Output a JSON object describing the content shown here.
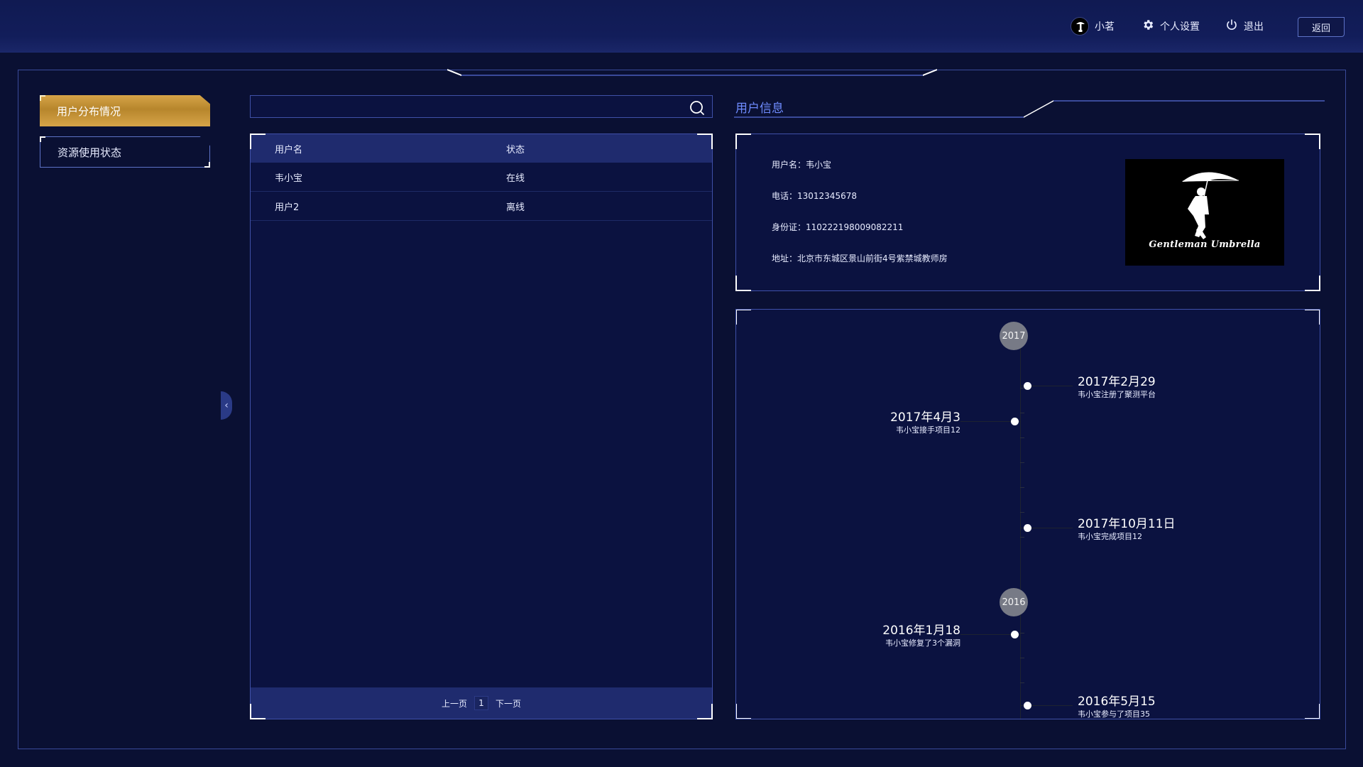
{
  "topbar": {
    "user_name": "小茗",
    "settings_label": "个人设置",
    "logout_label": "退出",
    "back_label": "返回"
  },
  "menu": {
    "items": [
      {
        "label": "用户分布情况",
        "active": true
      },
      {
        "label": "资源使用状态",
        "active": false
      }
    ]
  },
  "search": {
    "value": "",
    "placeholder": ""
  },
  "table": {
    "headers": {
      "name": "用户名",
      "status": "状态"
    },
    "rows": [
      {
        "name": "韦小宝",
        "status": "在线"
      },
      {
        "name": "用户2",
        "status": "离线"
      }
    ]
  },
  "pager": {
    "prev_label": "上一页",
    "current": "1",
    "next_label": "下一页"
  },
  "user_info": {
    "title": "用户信息",
    "name_line": "用户名：韦小宝",
    "phone_line": "电话：13012345678",
    "id_line": "身份证：110222198009082211",
    "address_line": "地址：北京市东城区景山前街4号紫禁城教师房",
    "portrait_caption": "Gentleman Umbrella"
  },
  "timeline": {
    "years": [
      "2017",
      "2016"
    ],
    "events": [
      {
        "date": "2017年2月29",
        "desc": "韦小宝注册了聚测平台",
        "side": "right"
      },
      {
        "date": "2017年4月3",
        "desc": "韦小宝接手项目12",
        "side": "left"
      },
      {
        "date": "2017年10月11日",
        "desc": "韦小宝完成项目12",
        "side": "right"
      },
      {
        "date": "2016年1月18",
        "desc": "韦小宝修复了3个漏洞",
        "side": "left"
      },
      {
        "date": "2016年5月15",
        "desc": "韦小宝参与了项目35",
        "side": "right"
      }
    ]
  },
  "colors": {
    "background": "#0a1033",
    "accent_gold": "#d6a448",
    "panel_border": "#3f50a8",
    "title_blue": "#6f8cff"
  },
  "icons": {
    "settings": "gear-icon",
    "logout": "power-icon",
    "search": "search-icon",
    "collapse": "chevron-left-icon"
  }
}
